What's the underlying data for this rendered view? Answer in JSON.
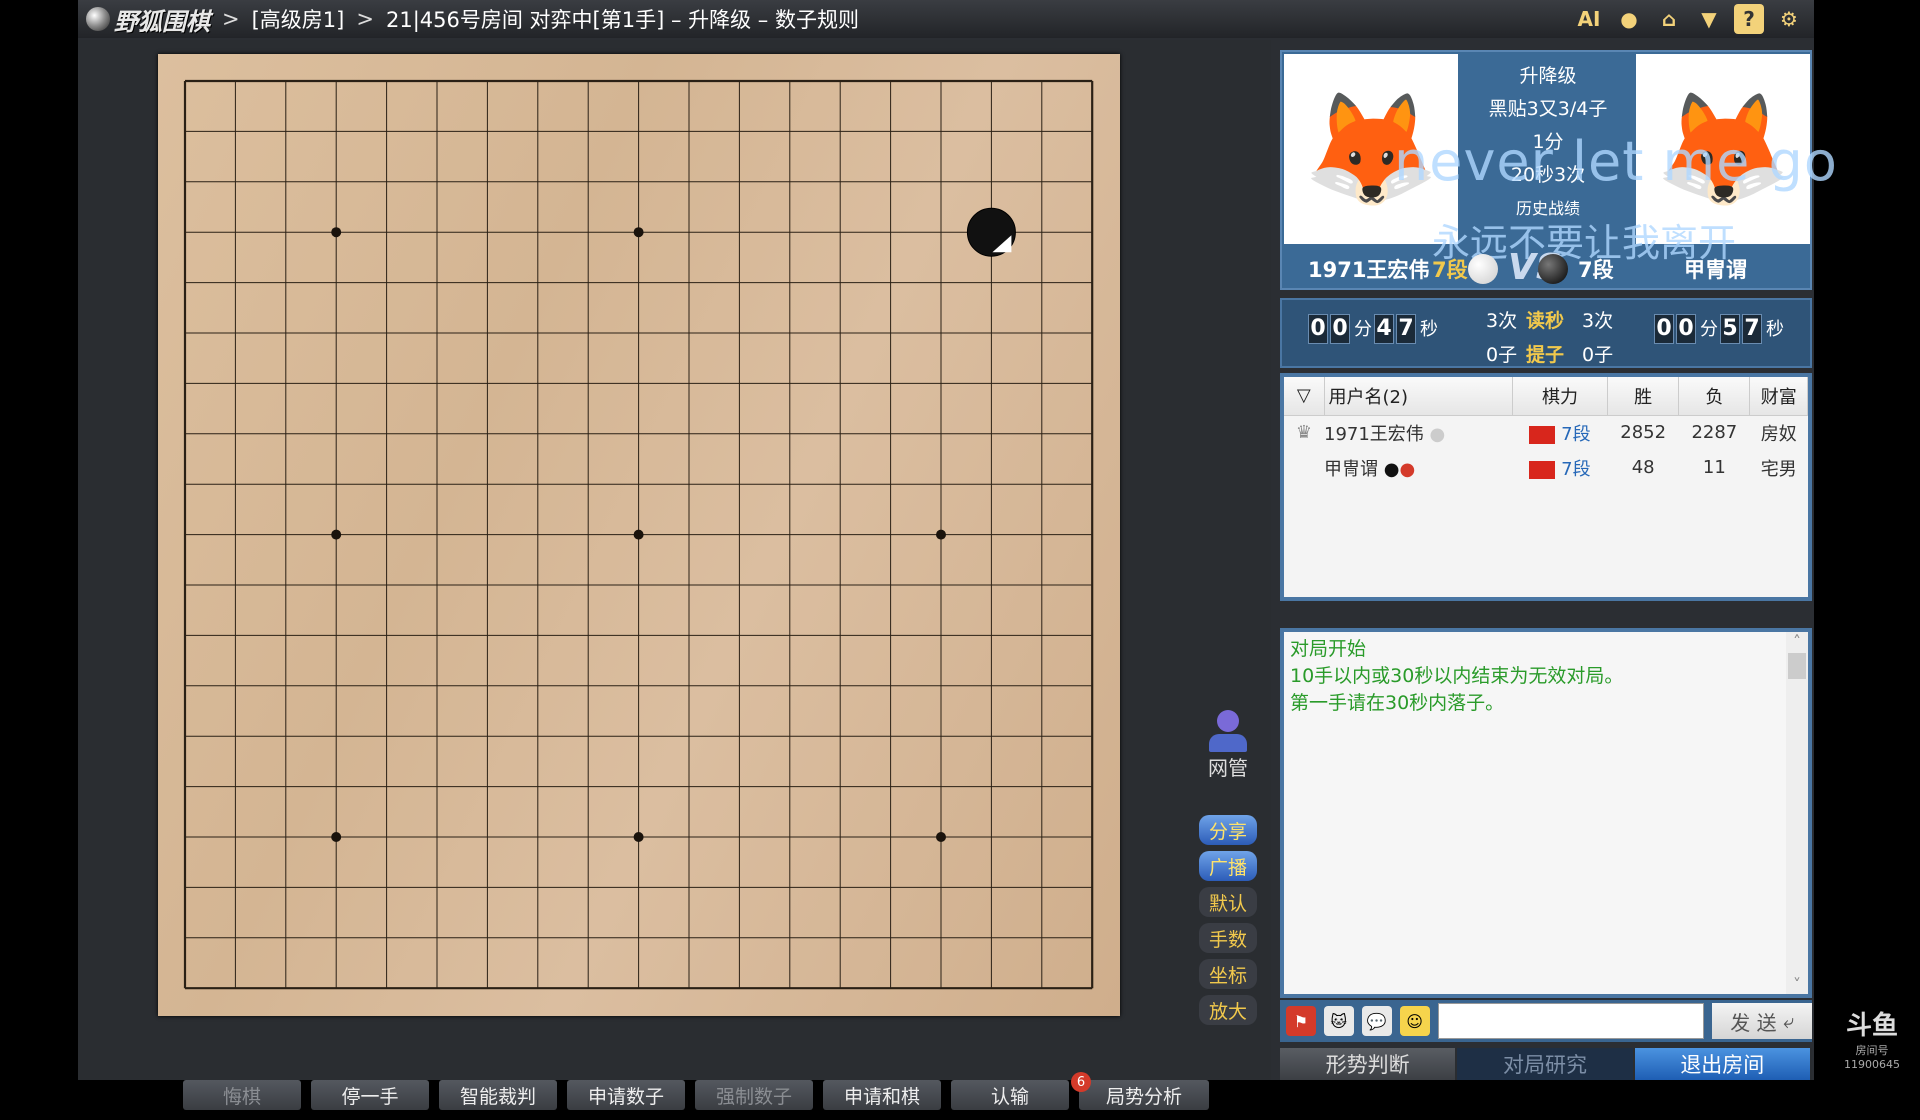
{
  "titlebar": {
    "app_name": "野狐围棋",
    "room": "[高级房1]",
    "breadcrumb": "21|456号房间 对弈中[第1手] – 升降级 – 数子规则",
    "icons": [
      "AI",
      "user-icon",
      "home-icon",
      "shirt-icon",
      "help-icon",
      "gear-icon"
    ],
    "ai_label": "AI"
  },
  "board": {
    "size": 19,
    "stones": [
      {
        "color": "black",
        "col": 16,
        "row": 3,
        "last_move": true
      }
    ],
    "star_points": [
      [
        3,
        3
      ],
      [
        9,
        3
      ],
      [
        15,
        3
      ],
      [
        3,
        9
      ],
      [
        9,
        9
      ],
      [
        15,
        9
      ],
      [
        3,
        15
      ],
      [
        9,
        15
      ],
      [
        15,
        15
      ]
    ],
    "hidden_star_point": [
      15,
      3
    ]
  },
  "tools": {
    "admin_label": "网管",
    "buttons": [
      "分享",
      "广播",
      "默认",
      "手数",
      "坐标",
      "放大"
    ]
  },
  "bottom_bar": {
    "undo": "悔棋",
    "pass": "停一手",
    "smart_judge": "智能裁判",
    "request_count": "申请数子",
    "force_count": "强制数子",
    "request_draw": "申请和棋",
    "resign": "认输",
    "analysis_badge": "6",
    "analysis": "局势分析"
  },
  "players": {
    "white_name": "1971王宏伟",
    "white_rank": "7段",
    "black_name": "甲冑谓",
    "black_rank": "7段",
    "vs": "VS",
    "info_line1": "升降级",
    "info_line2": "黑贴3又3/4子",
    "info_line3": "1分",
    "info_line4": "20秒3次",
    "info_line5": "历史战绩",
    "overlay_en": "never let me go",
    "overlay_cn": "永远不要让我离开"
  },
  "clocks": {
    "left_digits": [
      "0",
      "0",
      "4",
      "7"
    ],
    "right_digits": [
      "0",
      "0",
      "5",
      "7"
    ],
    "min_unit": "分",
    "sec_unit": "秒",
    "left_byoyomi": "3次",
    "right_byoyomi": "3次",
    "byoyomi_label": "读秒",
    "left_captures": "0子",
    "right_captures": "0子",
    "captures_label": "提子"
  },
  "userlist": {
    "headers": [
      "用户名(2)",
      "棋力",
      "胜",
      "负",
      "财富"
    ],
    "rows": [
      {
        "name": "1971王宏伟",
        "rank": "7段",
        "wins": "2852",
        "losses": "2287",
        "wealth": "房奴"
      },
      {
        "name": "甲冑谓",
        "rank": "7段",
        "wins": "48",
        "losses": "11",
        "wealth": "宅男"
      }
    ]
  },
  "chat": {
    "lines": [
      "对局开始",
      "10手以内或30秒以内结束为无效对局。",
      "第一手请在30秒内落子。"
    ],
    "send_label": "发 送"
  },
  "right_tabs": {
    "judge": "形势判断",
    "research": "对局研究",
    "exit": "退出房间"
  },
  "watermark": {
    "logo": "斗鱼",
    "sub": "房间号",
    "id": "11900645"
  },
  "colors": {
    "accent_blue": "#3b6a96",
    "chat_green": "#2a9b2a",
    "gold": "#f2c94c"
  }
}
